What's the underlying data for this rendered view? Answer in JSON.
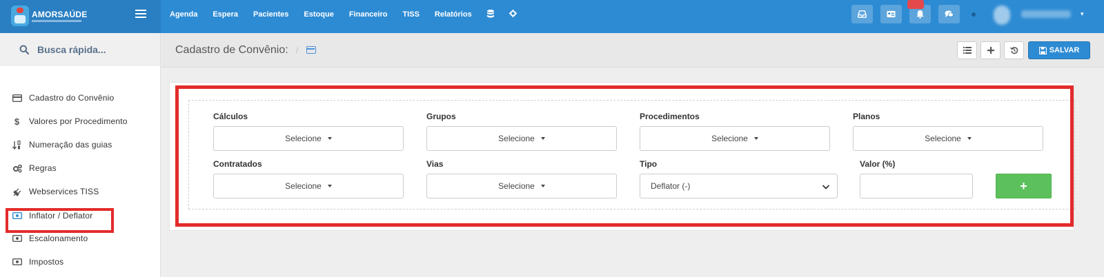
{
  "brand": {
    "name": "AMORSAÚDE"
  },
  "nav": {
    "items": [
      "Agenda",
      "Espera",
      "Pacientes",
      "Estoque",
      "Financeiro",
      "TISS",
      "Relatórios"
    ],
    "icons": [
      "database-icon",
      "gear-icon"
    ]
  },
  "sidebar": {
    "search_placeholder": "Busca rápida...",
    "items": [
      {
        "label": "Cadastro do Convênio",
        "icon": "credit-card-icon"
      },
      {
        "label": "Valores por Procedimento",
        "icon": "dollar-icon"
      },
      {
        "label": "Numeração das guias",
        "icon": "sort-numeric-icon"
      },
      {
        "label": "Regras",
        "icon": "cogs-icon"
      },
      {
        "label": "Webservices TISS",
        "icon": "plug-icon"
      },
      {
        "label": "Inflator / Deflator",
        "icon": "money-icon",
        "active": true
      },
      {
        "label": "Escalonamento",
        "icon": "money-icon"
      },
      {
        "label": "Impostos",
        "icon": "money-icon"
      }
    ]
  },
  "header": {
    "title": "Cadastro de Convênio:",
    "separator": "/",
    "save_label": "SALVAR"
  },
  "form": {
    "row1": [
      {
        "label": "Cálculos",
        "value": "Selecione"
      },
      {
        "label": "Grupos",
        "value": "Selecione"
      },
      {
        "label": "Procedimentos",
        "value": "Selecione"
      },
      {
        "label": "Planos",
        "value": "Selecione"
      }
    ],
    "row2": [
      {
        "label": "Contratados",
        "value": "Selecione"
      },
      {
        "label": "Vias",
        "value": "Selecione"
      }
    ],
    "tipo": {
      "label": "Tipo",
      "value": "Deflator (-)"
    },
    "valor": {
      "label": "Valor (%)",
      "value": ""
    },
    "add_label": "+"
  },
  "colors": {
    "topbar": "#2d8bd3",
    "brand_bg": "#2a7fc3",
    "highlight": "#e32b2b",
    "add_button": "#5cc15c",
    "save_button": "#2d8bd3"
  }
}
